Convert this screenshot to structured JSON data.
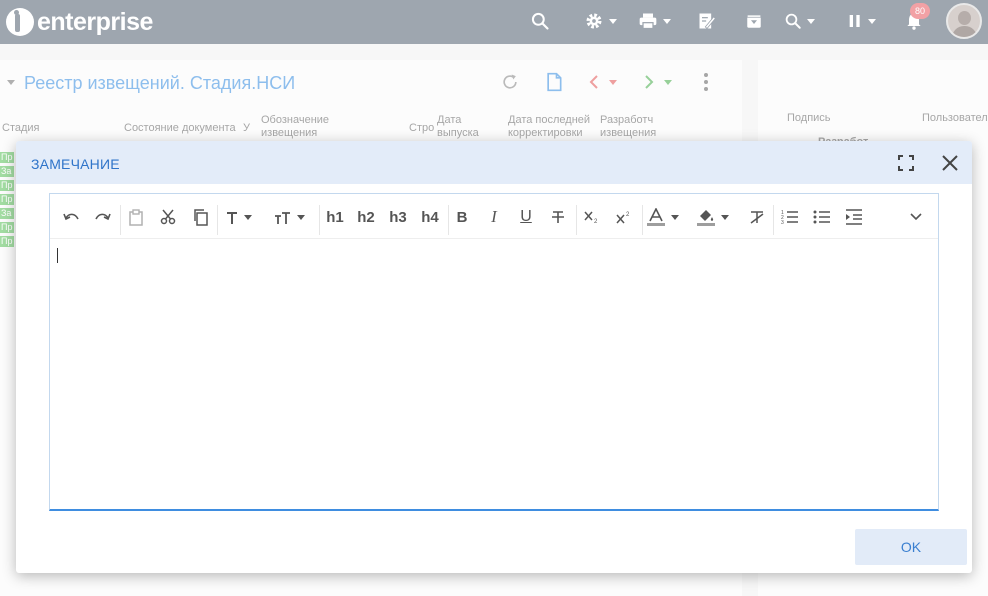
{
  "topbar": {
    "logo_text": "enterprise",
    "notification_count": "80"
  },
  "registry": {
    "title": "Реестр извещений. Стадия.НСИ",
    "columns": [
      "Стадия",
      "Состояние документа",
      "У",
      "Обозначение извещения",
      "Стро",
      "Дата выпуска",
      "Дата последней корректировки",
      "Разработч извещения"
    ],
    "row_tags": [
      "Пр",
      "За",
      "Пр",
      "Пр",
      "За",
      "Пр",
      "Пр"
    ]
  },
  "right_panel": {
    "columns": [
      "Подпись",
      "Пользовател"
    ],
    "row_text": "Разработ"
  },
  "dialog": {
    "title": "ЗАМЕЧАНИЕ",
    "toolbar_text": {
      "heading1": "h1",
      "heading2": "h2",
      "heading3": "h3",
      "heading4": "h4",
      "bold": "B",
      "italic": "I",
      "underline": "U"
    },
    "editor_value": "",
    "ok_label": "OK"
  },
  "colors": {
    "topbar": "#4f5d6e",
    "accent": "#2f74c9",
    "dialog_header": "#e3ecf9",
    "badge": "#e8545c",
    "row_tag": "#5fc35f"
  },
  "icons": [
    "search-icon",
    "gear-icon",
    "print-icon",
    "edit-icon",
    "archive-icon",
    "search-filter-icon",
    "pause-icon",
    "bell-icon",
    "undo-icon",
    "redo-icon",
    "paste-icon",
    "cut-icon",
    "copy-icon",
    "font-family-icon",
    "font-size-icon",
    "strikethrough-icon",
    "subscript-icon",
    "superscript-icon",
    "text-color-icon",
    "highlight-icon",
    "clear-format-icon",
    "ordered-list-icon",
    "bullet-list-icon",
    "indent-icon",
    "more-icon",
    "fullscreen-icon",
    "close-icon"
  ]
}
